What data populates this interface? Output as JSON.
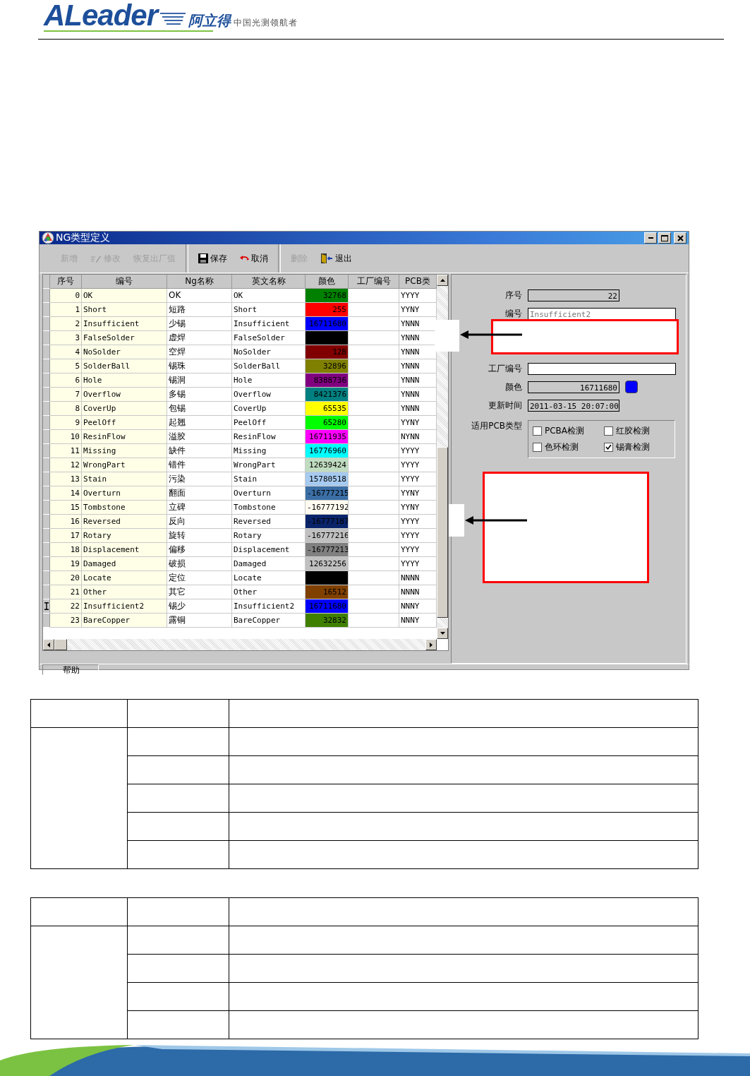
{
  "header": {
    "logo": "ALeader",
    "brand": "阿立得",
    "tagline": "中国光测领航者"
  },
  "window": {
    "title": "NG类型定义"
  },
  "toolbar": [
    {
      "label": "新增",
      "disabled": true,
      "separator_after": false
    },
    {
      "label": "修改",
      "disabled": true,
      "separator_after": false
    },
    {
      "label": "恢复出厂值",
      "disabled": true,
      "separator_after": true
    },
    {
      "label": "保存",
      "disabled": false,
      "separator_after": false
    },
    {
      "label": "取消",
      "disabled": false,
      "separator_after": true
    },
    {
      "label": "删除",
      "disabled": true,
      "separator_after": false
    },
    {
      "label": "退出",
      "disabled": false,
      "separator_after": false
    }
  ],
  "table": {
    "columns": [
      "序号",
      "编号",
      "Ng名称",
      "英文名称",
      "颜色",
      "工厂编号",
      "PCB类"
    ],
    "rows": [
      {
        "index": "0",
        "code": "OK",
        "ng_name": "OK",
        "en_name": "OK",
        "color_value": "32768",
        "color": "#008000",
        "pcb": "YYYY",
        "selected": false
      },
      {
        "index": "1",
        "code": "Short",
        "ng_name": "短路",
        "en_name": "Short",
        "color_value": "255",
        "color": "#ff0000",
        "pcb": "YYNY",
        "selected": false
      },
      {
        "index": "2",
        "code": "Insufficient",
        "ng_name": "少锡",
        "en_name": "Insufficient",
        "color_value": "16711680",
        "color": "#0000ff",
        "pcb": "YNNN",
        "selected": false
      },
      {
        "index": "3",
        "code": "FalseSolder",
        "ng_name": "虚焊",
        "en_name": "FalseSolder",
        "color": "#000000",
        "pcb": "YNNN",
        "selected": false
      },
      {
        "index": "4",
        "code": "NoSolder",
        "ng_name": "空焊",
        "en_name": "NoSolder",
        "color_value": "128",
        "color": "#800000",
        "pcb": "YNNN",
        "selected": false
      },
      {
        "index": "5",
        "code": "SolderBall",
        "ng_name": "锡珠",
        "en_name": "SolderBall",
        "color_value": "32896",
        "color": "#808000",
        "pcb": "YNNN",
        "selected": false
      },
      {
        "index": "6",
        "code": "Hole",
        "ng_name": "锡洞",
        "en_name": "Hole",
        "color_value": "8388736",
        "color": "#800080",
        "pcb": "YNNN",
        "selected": false
      },
      {
        "index": "7",
        "code": "Overflow",
        "ng_name": "多锡",
        "en_name": "Overflow",
        "color_value": "8421376",
        "color": "#008080",
        "pcb": "YNNN",
        "selected": false
      },
      {
        "index": "8",
        "code": "CoverUp",
        "ng_name": "包锡",
        "en_name": "CoverUp",
        "color_value": "65535",
        "color": "#ffff00",
        "pcb": "YNNN",
        "selected": false
      },
      {
        "index": "9",
        "code": "PeelOff",
        "ng_name": "起翘",
        "en_name": "PeelOff",
        "color_value": "65280",
        "color": "#00ff00",
        "pcb": "YYNY",
        "selected": false
      },
      {
        "index": "10",
        "code": "ResinFlow",
        "ng_name": "溢胶",
        "en_name": "ResinFlow",
        "color_value": "16711935",
        "color": "#ff00ff",
        "pcb": "NYNN",
        "selected": false
      },
      {
        "index": "11",
        "code": "Missing",
        "ng_name": "缺件",
        "en_name": "Missing",
        "color_value": "16776960",
        "color": "#00ffff",
        "pcb": "YYYY",
        "selected": false
      },
      {
        "index": "12",
        "code": "WrongPart",
        "ng_name": "错件",
        "en_name": "WrongPart",
        "color_value": "12639424",
        "color": "#c0dcc0",
        "pcb": "YYYY",
        "selected": false
      },
      {
        "index": "13",
        "code": "Stain",
        "ng_name": "污染",
        "en_name": "Stain",
        "color_value": "15780518",
        "color": "#a6caf0",
        "pcb": "YYYY",
        "selected": false
      },
      {
        "index": "14",
        "code": "Overturn",
        "ng_name": "翻面",
        "en_name": "Overturn",
        "color_value": "-16777215",
        "color": "#3a6ea5",
        "pcb": "YYNY",
        "selected": false
      },
      {
        "index": "15",
        "code": "Tombstone",
        "ng_name": "立碑",
        "en_name": "Tombstone",
        "color_value": "-16777192",
        "color": "#fffbf0",
        "pcb": "YYNY",
        "selected": false
      },
      {
        "index": "16",
        "code": "Reversed",
        "ng_name": "反向",
        "en_name": "Reversed",
        "color_value": "-16777187",
        "color": "#0a246a",
        "pcb": "YYYY",
        "selected": false
      },
      {
        "index": "17",
        "code": "Rotary",
        "ng_name": "旋转",
        "en_name": "Rotary",
        "color_value": "-16777216",
        "color": "#c0c0c0",
        "pcb": "YYYY",
        "selected": false
      },
      {
        "index": "18",
        "code": "Displacement",
        "ng_name": "偏移",
        "en_name": "Displacement",
        "color_value": "-16777213",
        "color": "#808080",
        "pcb": "YYYY",
        "selected": false
      },
      {
        "index": "19",
        "code": "Damaged",
        "ng_name": "破损",
        "en_name": "Damaged",
        "color_value": "12632256",
        "color": "#c0c0c0",
        "pcb": "YYYY",
        "selected": false
      },
      {
        "index": "20",
        "code": "Locate",
        "ng_name": "定位",
        "en_name": "Locate",
        "color": "#000000",
        "pcb": "NNNN",
        "selected": false
      },
      {
        "index": "21",
        "code": "Other",
        "ng_name": "其它",
        "en_name": "Other",
        "color_value": "16512",
        "color": "#804000",
        "pcb": "NNNN",
        "selected": false
      },
      {
        "index": "22",
        "code": "Insufficient2",
        "ng_name": "锡少",
        "en_name": "Insufficient2",
        "color_value": "16711680",
        "color": "#0000ff",
        "pcb": "NNNY",
        "selected": true
      },
      {
        "index": "23",
        "code": "BareCopper",
        "ng_name": "露铜",
        "en_name": "BareCopper",
        "color_value": "32832",
        "color": "#408000",
        "pcb": "NNNY",
        "selected": false
      }
    ]
  },
  "detail": {
    "fields": [
      {
        "label": "序号",
        "value": "22",
        "kind": "short",
        "readonly": true
      },
      {
        "label": "编号",
        "value": "Insufficient2",
        "kind": "long",
        "readonly": false
      },
      {
        "kind": "hidden"
      },
      {
        "kind": "hidden"
      },
      {
        "label": "工厂编号",
        "kind": "long",
        "readonly": false
      },
      {
        "label": "颜色",
        "value": "16711680",
        "kind": "color",
        "color": "#0000ff",
        "readonly": true
      },
      {
        "label": "更新时间",
        "value": "2011-03-15 20:07:00",
        "kind": "short",
        "readonly": true
      }
    ],
    "pcb_types": {
      "label": "适用PCB类型",
      "options": [
        {
          "label": "PCBA检测",
          "checked": false
        },
        {
          "label": "红胶检测",
          "checked": false
        },
        {
          "label": "色环检测",
          "checked": false
        },
        {
          "label": "锡膏检测",
          "checked": true
        }
      ]
    }
  },
  "status_bar": {
    "help": "帮助"
  }
}
